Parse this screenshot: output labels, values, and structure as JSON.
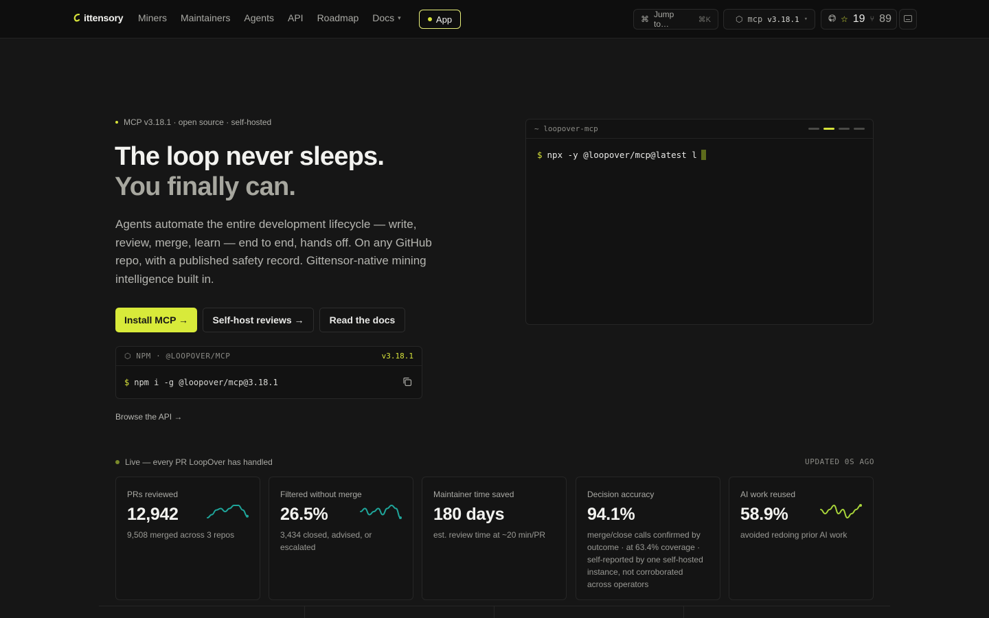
{
  "nav": {
    "brand": "ittensory",
    "items": [
      "Miners",
      "Maintainers",
      "Agents",
      "API",
      "Roadmap"
    ],
    "docs": "Docs",
    "app_button": "App",
    "jump": "Jump to…",
    "jump_kbd": "⌘K",
    "version_prefix": "mcp",
    "version": "v3.18.1",
    "stars": "19",
    "forks": "89"
  },
  "hero": {
    "eyebrow": "MCP v3.18.1 · open source · self-hosted",
    "title_line1": "The loop never sleeps.",
    "title_line2": "You finally can.",
    "lede": "Agents automate the entire development lifecycle — write, review, merge, learn — end to end, hands off. On any GitHub repo, with a published safety record. Gittensor-native mining intelligence built in.",
    "buttons": {
      "install": "Install MCP →",
      "selfhost": "Self-host reviews →",
      "docs": "Read the docs"
    },
    "npm": {
      "label": "NPM · @LOOPOVER/MCP",
      "version": "v3.18.1",
      "prompt": "$",
      "command": "npm i -g @loopover/mcp@3.18.1"
    },
    "browse": "Browse the API →"
  },
  "terminal": {
    "title": "~ loopover-mcp",
    "prompt": "$",
    "command": "npx -y @loopover/mcp@latest l"
  },
  "live": {
    "label": "Live — every PR LoopOver has handled",
    "updated": "UPDATED 0S AGO",
    "stats": [
      {
        "label": "PRs reviewed",
        "value": "12,942",
        "sub": "9,508 merged across 3 repos",
        "spark": [
          10,
          8,
          5,
          4,
          6,
          4,
          2,
          2,
          5,
          9
        ]
      },
      {
        "label": "Filtered without merge",
        "value": "26.5%",
        "sub": "3,434 closed, advised, or escalated",
        "spark": [
          5,
          4,
          6,
          5,
          4,
          6,
          4,
          3,
          4,
          7
        ]
      },
      {
        "label": "Maintainer time saved",
        "value": "180 days",
        "sub": "est. review time at ~20 min/PR"
      },
      {
        "label": "Decision accuracy",
        "value": "94.1%",
        "sub": "merge/close calls confirmed by outcome · at 63.4% coverage · self-reported by one self-hosted instance, not corroborated across operators"
      },
      {
        "label": "AI work reused",
        "value": "58.9%",
        "sub": "avoided redoing prior AI work",
        "spark": [
          5,
          6,
          5,
          4,
          6,
          5,
          7,
          6,
          5,
          4
        ]
      }
    ]
  },
  "colors": {
    "accent": "#d8ea3a",
    "background": "#161616",
    "spark_teal": "#1fa59a",
    "spark_green": "#a8d43a"
  }
}
